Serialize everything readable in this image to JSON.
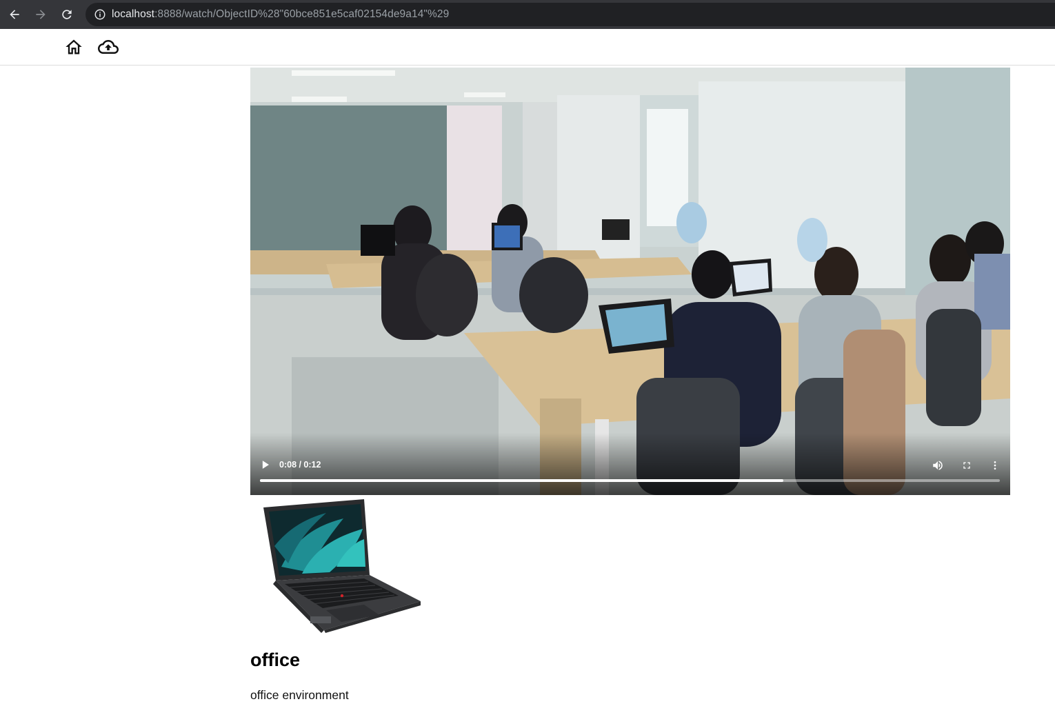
{
  "browser": {
    "url_host": "localhost",
    "url_path": ":8888/watch/ObjectID%28\"60bce851e5caf02154de9a14\"%29"
  },
  "header": {
    "home_icon": "home-icon",
    "upload_icon": "cloud-upload-icon"
  },
  "video": {
    "time_display": "0:08 / 0:12",
    "progress_fraction": 0.707,
    "play_icon": "play-icon",
    "volume_icon": "volume-icon",
    "fullscreen_icon": "fullscreen-icon",
    "more_icon": "more-vert-icon"
  },
  "thumbnail": {
    "icon": "laptop-image"
  },
  "post": {
    "title": "office",
    "description": "office environment"
  }
}
